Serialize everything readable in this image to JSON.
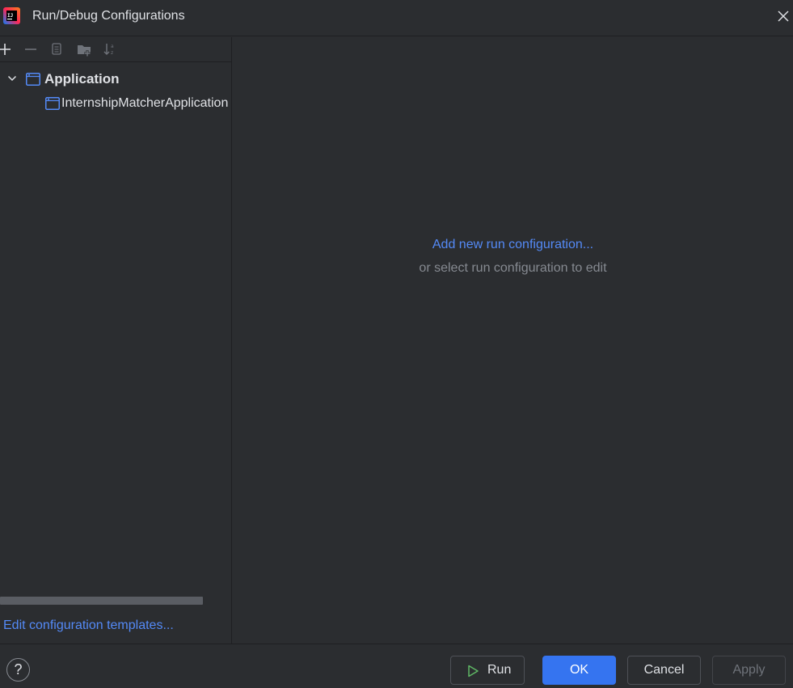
{
  "window": {
    "title": "Run/Debug Configurations",
    "logo_icon": "intellij-idea-logo-icon",
    "close_icon": "close-icon"
  },
  "toolbar": {
    "icons": [
      "add-icon",
      "remove-icon",
      "copy-icon",
      "new-folder-icon",
      "sort-alphabetically-icon"
    ]
  },
  "tree": {
    "group": {
      "label": "Application",
      "expanded": true,
      "icon": "application-config-icon"
    },
    "items": [
      {
        "label": "InternshipMatcherApplication",
        "icon": "application-config-icon"
      }
    ]
  },
  "left_footer": {
    "edit_templates_label": "Edit configuration templates..."
  },
  "empty_state": {
    "add_new_label": "Add new run configuration...",
    "hint": "or select run configuration to edit"
  },
  "buttons": {
    "help_label": "?",
    "run_label": "Run",
    "ok_label": "OK",
    "cancel_label": "Cancel",
    "apply_label": "Apply"
  },
  "colors": {
    "background": "#2b2d30",
    "link": "#548af7",
    "primary_button": "#3574f0",
    "muted_text": "#868a91"
  }
}
